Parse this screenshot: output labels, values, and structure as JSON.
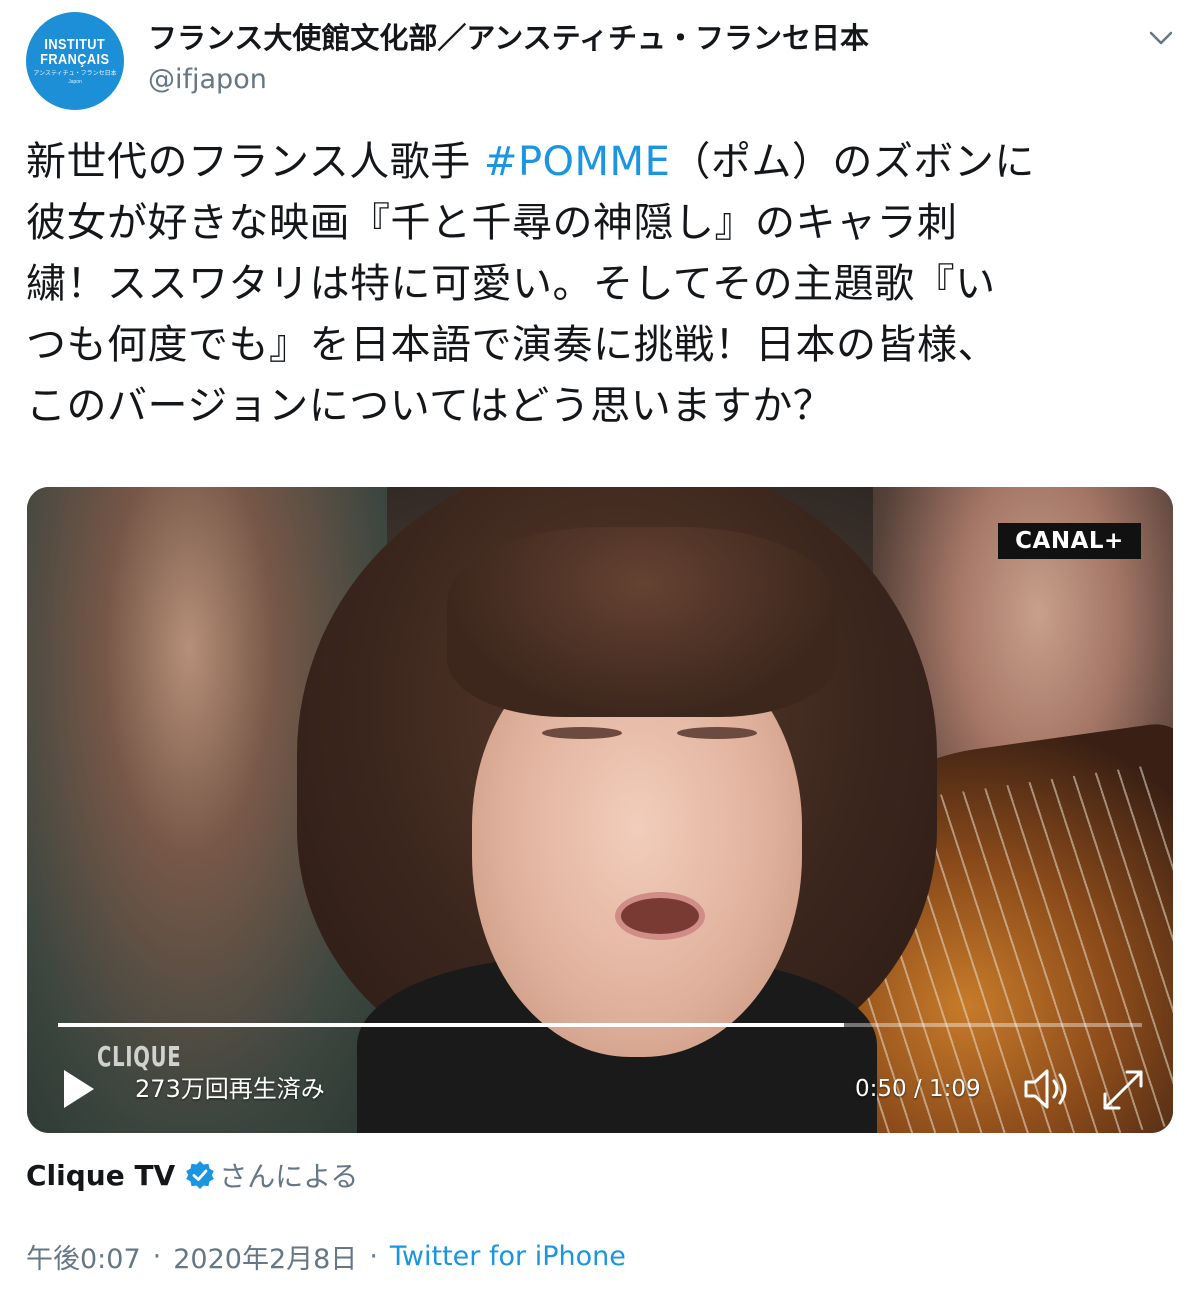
{
  "account": {
    "avatar_text_line1": "INSTITUT",
    "avatar_text_line2": "FRANÇAIS",
    "avatar_subtext": "アンスティチュ・フランセ日本",
    "avatar_subtext2": "Japon",
    "display_name": "フランス大使館文化部／アンスティチュ・フランセ日本",
    "handle": "@ifjapon"
  },
  "tweet": {
    "line1_pre": "新世代のフランス人歌手 ",
    "hashtag": "#POMME",
    "line1_post": "（ポム）のズボンに",
    "line2": "彼女が好きな映画『千と千尋の神隠し』のキャラ刺",
    "line3": "繍！ススワタリは特に可愛い。そしてその主題歌『い",
    "line4": "つも何度でも』を日本語で演奏に挑戦！日本の皆様、",
    "line5": "このバージョンについてはどう思いますか？"
  },
  "video": {
    "channel_watermark": "CANAL+",
    "clique_watermark": "CLIQUE",
    "views": "273万回再生済み",
    "timecode": "0:50 / 1:09",
    "progress": 0.725
  },
  "attribution": {
    "source_name": "Clique TV",
    "by_text": "さんによる"
  },
  "footer": {
    "time": "午後0:07",
    "separator": "·",
    "date": "2020年2月8日",
    "client": "Twitter for iPhone"
  },
  "icons": {
    "chevron": "chevron-down-icon",
    "verified": "verified-badge-icon",
    "play": "play-icon",
    "volume": "volume-icon",
    "fullscreen": "fullscreen-icon"
  },
  "colors": {
    "link": "#1b95e0",
    "text": "#14171a",
    "secondary": "#657786",
    "avatar_bg": "#1c8fd6"
  }
}
